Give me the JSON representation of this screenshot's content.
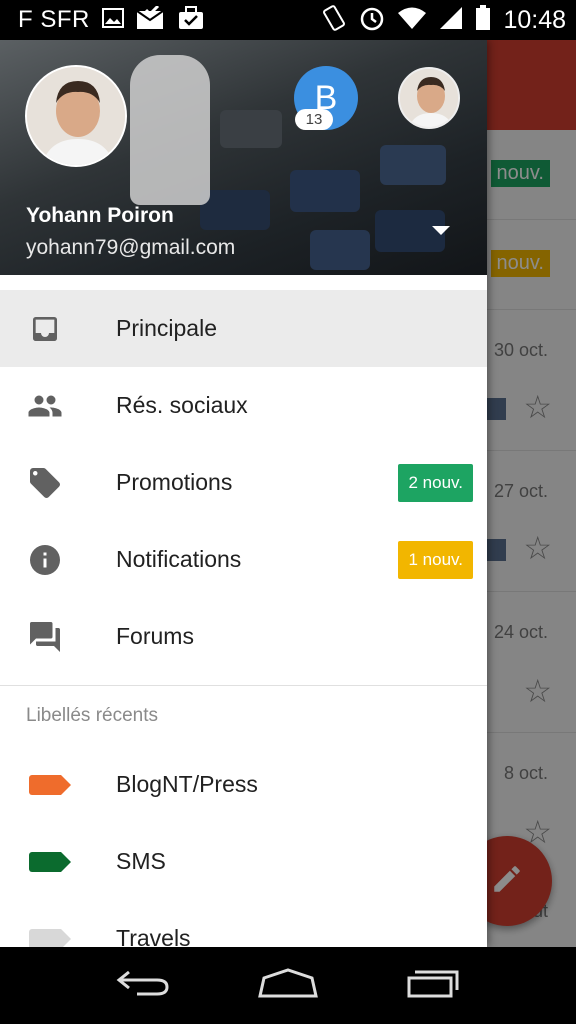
{
  "status_bar": {
    "carrier": "F SFR",
    "time": "10:48",
    "icons": [
      "image-icon",
      "mail-check-icon",
      "briefcase-check-icon",
      "rotate-icon",
      "alarm-icon",
      "wifi-icon",
      "signal-icon",
      "battery-icon"
    ]
  },
  "drawer": {
    "account": {
      "name": "Yohann Poiron",
      "email": "yohann79@gmail.com",
      "other_account_initial": "B",
      "other_account_count": "13"
    },
    "items": [
      {
        "label": "Principale",
        "icon": "inbox-icon",
        "selected": true
      },
      {
        "label": "Rés. sociaux",
        "icon": "people-icon"
      },
      {
        "label": "Promotions",
        "icon": "tag-icon",
        "badge": "2 nouv.",
        "badge_color": "#1da462"
      },
      {
        "label": "Notifications",
        "icon": "info-icon",
        "badge": "1 nouv.",
        "badge_color": "#f2b600"
      },
      {
        "label": "Forums",
        "icon": "forum-icon"
      }
    ],
    "recent_labels_title": "Libellés récents",
    "labels": [
      {
        "label": "BlogNT/Press",
        "color": "#ef6c2c"
      },
      {
        "label": "SMS",
        "color": "#0b6b2e"
      },
      {
        "label": "Travels",
        "color": "#d8d8d8"
      }
    ]
  },
  "background_inbox": {
    "tags": [
      {
        "text": "nouv.",
        "color": "#1da462"
      },
      {
        "text": "nouv.",
        "color": "#f2b600"
      }
    ],
    "dates": [
      "30 oct.",
      "27 oct.",
      "24 oct.",
      "8 oct."
    ],
    "partial_text": "out"
  },
  "colors": {
    "accent_red": "#d23f31",
    "account_blue": "#3b8fe0"
  }
}
